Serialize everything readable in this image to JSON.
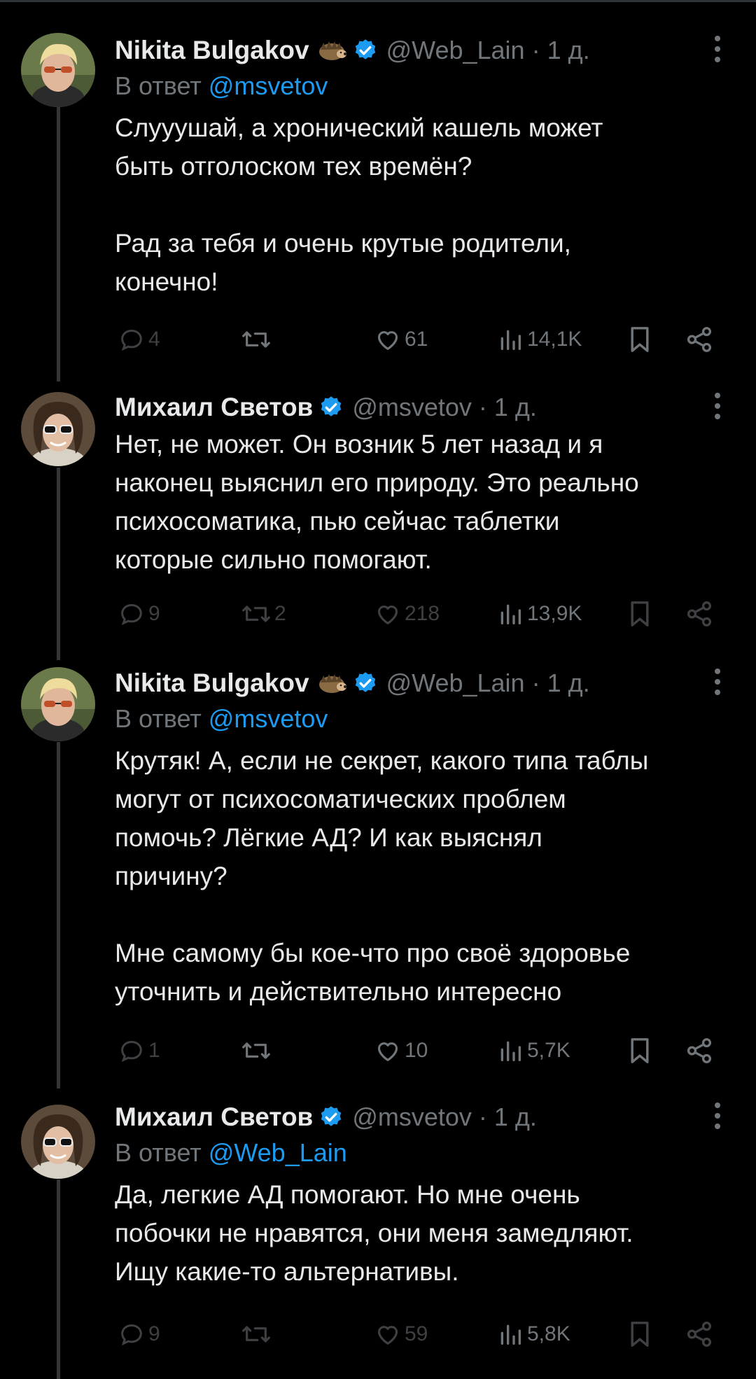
{
  "tweets": [
    {
      "name": "Nikita Bulgakov",
      "has_emoji": true,
      "emoji_icon": "hedgehog-emoji",
      "verified": true,
      "handle": "@Web_Lain",
      "time": "· 1 д.",
      "reply_prefix": "В ответ ",
      "reply_to": "@msvetov",
      "text": "Слууушай, а хронический кашель может\nбыть отголоском тех времён?\n\nРад за тебя и очень крутые родители,\nконечно!",
      "replies": "4",
      "retweets": "",
      "likes": "61",
      "views": "14,1K"
    },
    {
      "name": "Михаил Светов",
      "has_emoji": false,
      "verified": true,
      "handle": "@msvetov",
      "time": "· 1 д.",
      "text": "Нет, не может. Он возник 5 лет назад и я\nнаконец выяснил его природу. Это реально\nпсихосоматика, пью сейчас таблетки\nкоторые сильно помогают.",
      "replies": "9",
      "retweets": "2",
      "likes": "218",
      "views": "13,9K"
    },
    {
      "name": "Nikita Bulgakov",
      "has_emoji": true,
      "emoji_icon": "hedgehog-emoji",
      "verified": true,
      "handle": "@Web_Lain",
      "time": "· 1 д.",
      "reply_prefix": "В ответ ",
      "reply_to": "@msvetov",
      "text": "Крутяк! А, если не секрет, какого типа таблы\nмогут от психосоматических проблем\nпомочь? Лёгкие АД? И как выяснял\nпричину?\n\nМне самому бы кое-что про своё здоровье\nуточнить и действительно интересно",
      "replies": "1",
      "retweets": "",
      "likes": "10",
      "views": "5,7K"
    },
    {
      "name": "Михаил Светов",
      "has_emoji": false,
      "verified": true,
      "handle": "@msvetov",
      "time": "· 1 д.",
      "reply_prefix": "В ответ ",
      "reply_to": "@Web_Lain",
      "text": "Да, легкие АД помогают. Но мне очень\nпобочки не нравятся, они меня замедляют.\nИщу какие-то альтернативы.",
      "replies": "9",
      "retweets": "",
      "likes": "59",
      "views": "5,8K"
    }
  ],
  "colors": {
    "background": "#000000",
    "text": "#e7e9ea",
    "secondary": "#71767b",
    "accent": "#1d9bf0",
    "thread_line": "#333639"
  }
}
